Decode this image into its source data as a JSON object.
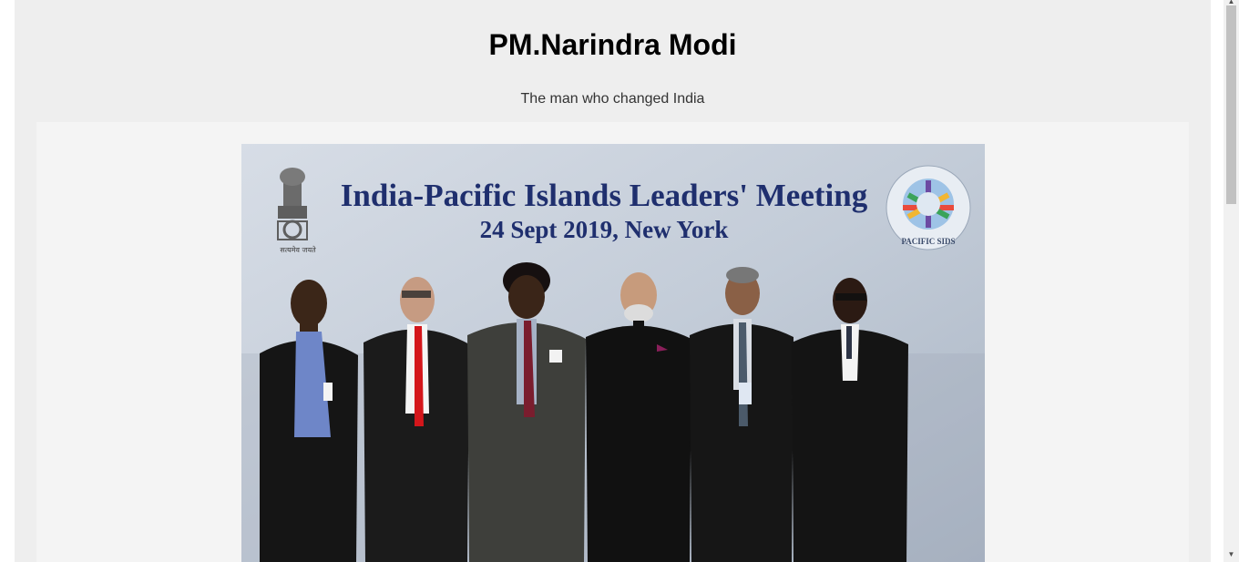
{
  "page": {
    "title": "PM.Narindra Modi",
    "tagline": "The man who changed India"
  },
  "photo": {
    "banner_line1": "India-Pacific Islands Leaders' Meeting",
    "banner_line2": "24 Sept 2019, New York",
    "emblem_caption": "सत्यमेव जयते",
    "logo_text": "PACIFIC SIDS",
    "background_color": "#c9d1dc",
    "banner_text_color": "#1f2f6e"
  },
  "scrollbar": {
    "up_icon": "▲",
    "down_icon": "▼"
  }
}
